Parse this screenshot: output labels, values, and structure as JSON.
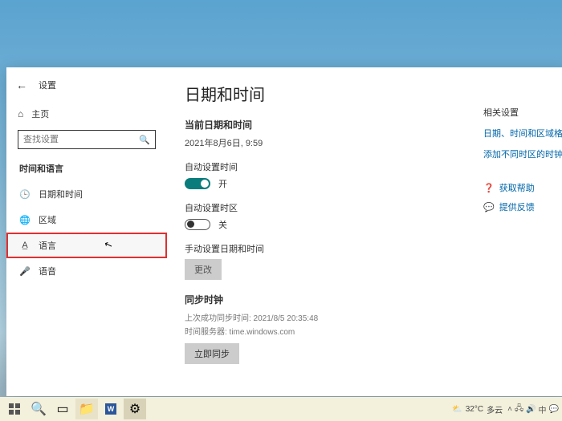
{
  "window": {
    "app_label": "设置",
    "home": "主页",
    "search_placeholder": "查找设置"
  },
  "sidebar": {
    "heading": "时间和语言",
    "items": [
      {
        "icon": "🕑",
        "label": "日期和时间"
      },
      {
        "icon": "🌐",
        "label": "区域"
      },
      {
        "icon": "🔤",
        "label": "语言"
      },
      {
        "icon": "🎤",
        "label": "语音"
      }
    ]
  },
  "main": {
    "title": "日期和时间",
    "current_label": "当前日期和时间",
    "current_value": "2021年8月6日, 9:59",
    "auto_time_label": "自动设置时间",
    "auto_time_state": "开",
    "auto_tz_label": "自动设置时区",
    "auto_tz_state": "关",
    "manual_label": "手动设置日期和时间",
    "change_btn": "更改",
    "sync_heading": "同步时钟",
    "last_sync": "上次成功同步时间: 2021/8/5 20:35:48",
    "time_server": "时间服务器: time.windows.com",
    "sync_btn": "立即同步"
  },
  "right": {
    "heading": "相关设置",
    "link1": "日期、时间和区域格式设置",
    "link2": "添加不同时区的时钟",
    "help": "获取帮助",
    "feedback": "提供反馈"
  },
  "taskbar": {
    "weather_temp": "32°C",
    "weather_desc": "多云"
  }
}
